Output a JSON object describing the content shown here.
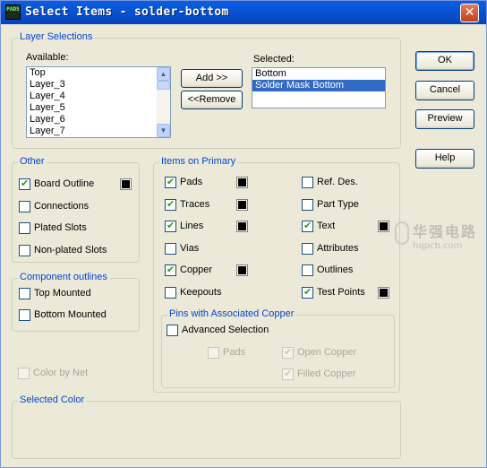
{
  "window": {
    "title": "Select Items - solder-bottom",
    "app_icon_text": "PADS",
    "close_glyph": "✕"
  },
  "layer_selections": {
    "legend": "Layer Selections",
    "available_label": "Available:",
    "available_items": [
      "Top",
      "Layer_3",
      "Layer_4",
      "Layer_5",
      "Layer_6",
      "Layer_7"
    ],
    "selected_label": "Selected:",
    "selected_items": [
      "Bottom",
      "Solder Mask Bottom"
    ],
    "add_button": "Add >>",
    "remove_button": "<<Remove"
  },
  "buttons": {
    "ok": "OK",
    "cancel": "Cancel",
    "preview": "Preview",
    "help": "Help"
  },
  "other": {
    "legend": "Other",
    "items": [
      {
        "label": "Board Outline",
        "checked": true,
        "swatch": true
      },
      {
        "label": "Connections",
        "checked": false
      },
      {
        "label": "Plated Slots",
        "checked": false
      },
      {
        "label": "Non-plated Slots",
        "checked": false
      }
    ]
  },
  "component_outlines": {
    "legend": "Component outlines",
    "items": [
      {
        "label": "Top Mounted",
        "checked": false
      },
      {
        "label": "Bottom Mounted",
        "checked": false
      }
    ]
  },
  "color_by_net": {
    "label": "Color by Net",
    "checked": false,
    "enabled": false
  },
  "items_on_primary": {
    "legend": "Items on Primary",
    "left": [
      {
        "label": "Pads",
        "checked": true,
        "swatch": true
      },
      {
        "label": "Traces",
        "checked": true,
        "swatch": true
      },
      {
        "label": "Lines",
        "checked": true,
        "swatch": true
      },
      {
        "label": "Vias",
        "checked": false
      },
      {
        "label": "Copper",
        "checked": true,
        "swatch": true
      },
      {
        "label": "Keepouts",
        "checked": false
      }
    ],
    "right": [
      {
        "label": "Ref. Des.",
        "checked": false
      },
      {
        "label": "Part Type",
        "checked": false
      },
      {
        "label": "Text",
        "checked": true,
        "swatch": true
      },
      {
        "label": "Attributes",
        "checked": false
      },
      {
        "label": "Outlines",
        "checked": false
      },
      {
        "label": "Test Points",
        "checked": true,
        "swatch": true
      }
    ]
  },
  "pins_copper": {
    "legend": "Pins with Associated Copper",
    "advanced": {
      "label": "Advanced Selection",
      "checked": false
    },
    "pads": {
      "label": "Pads",
      "checked": false,
      "enabled": false
    },
    "open_copper": {
      "label": "Open Copper",
      "checked": true,
      "enabled": false
    },
    "filled_copper": {
      "label": "Filled Copper",
      "checked": true,
      "enabled": false
    }
  },
  "selected_color": {
    "legend": "Selected Color"
  },
  "watermark": {
    "cn": "华强电路",
    "url": "hqpcb.com"
  },
  "colors": {
    "title_bar": "#0a5fe3",
    "dialog_bg": "#ece9d8",
    "legend_text": "#0046d5",
    "selection": "#316ac5",
    "swatch": "#000000"
  }
}
